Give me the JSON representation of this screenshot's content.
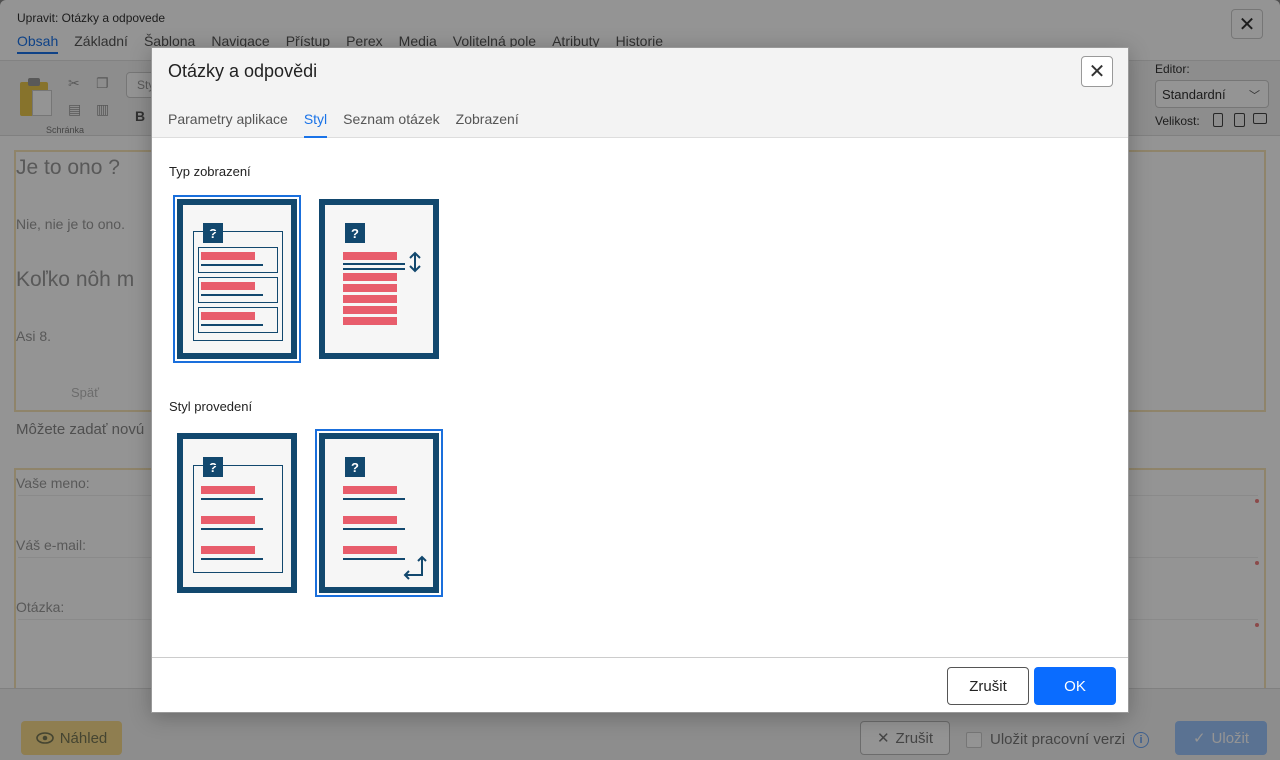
{
  "window": {
    "title": "Upravit: Otázky a odpovede",
    "tabs": [
      "Obsah",
      "Základní",
      "Šablona",
      "Navigace",
      "Přístup",
      "Perex",
      "Media",
      "Volitelná pole",
      "Atributy",
      "Historie"
    ],
    "active_tab": "Obsah"
  },
  "toolbar": {
    "clipboard_label": "Schránka",
    "style_placeholder": "Sty",
    "bold_label": "B",
    "editor_label": "Editor:",
    "editor_value": "Standardní",
    "size_label": "Velikost:"
  },
  "content": {
    "q1": "Je to ono ?",
    "a1": "Nie, nie je to ono.",
    "q2": "Koľko nôh m",
    "a2": "Asi 8.",
    "back": "Späť",
    "new_question": "Môžete zadať novú",
    "name_label": "Vaše meno:",
    "email_label": "Váš e-mail:",
    "question_label": "Otázka:"
  },
  "footer": {
    "preview_label": "Náhled",
    "cancel_label": "Zrušit",
    "save_work_label": "Uložit pracovní verzi",
    "save_label": "Uložit"
  },
  "modal": {
    "title": "Otázky a odpovědi",
    "tabs": [
      "Parametry aplikace",
      "Styl",
      "Seznam otázek",
      "Zobrazení"
    ],
    "active_tab": "Styl",
    "display_type_label": "Typ zobrazení",
    "style_label": "Styl provedení",
    "question_glyph": "?",
    "cancel_label": "Zrušit",
    "ok_label": "OK"
  },
  "colors": {
    "accent": "#1a73e8",
    "ok_button": "#0a6cff",
    "card_border": "#12486e",
    "card_bar": "#e85d6c",
    "frame": "#f6e4b7",
    "preview_button": "#f6d98b",
    "save_button": "#9cc4fb"
  },
  "icons": {
    "close": "close-icon",
    "preview": "eye-icon",
    "save": "check-icon",
    "info": "info-icon",
    "resize": "vertical-arrows-icon",
    "return": "return-arrow-icon"
  }
}
